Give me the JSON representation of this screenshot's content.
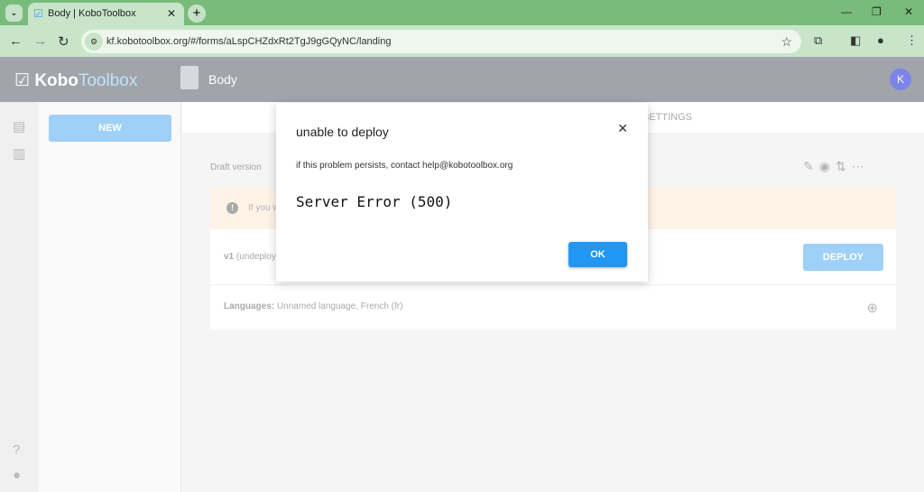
{
  "browser": {
    "tab_title": "Body | KoboToolbox",
    "url": "kf.kobotoolbox.org/#/forms/aLspCHZdxRt2TgJ9gGQyNC/landing"
  },
  "header": {
    "logo_a": "Kobo",
    "logo_b": "Toolbox",
    "title": "Body",
    "avatar": "K"
  },
  "sidebar": {
    "new_label": "NEW"
  },
  "topnav": {
    "settings": "SETTINGS"
  },
  "main": {
    "draft": "Draft version",
    "alert": "If you w",
    "version": "v1",
    "version_status": "(undeploy",
    "deploy": "DEPLOY",
    "languages_label": "Languages:",
    "languages": "Unnamed language, French (fr)"
  },
  "modal": {
    "title": "unable to deploy",
    "message": "if this problem persists, contact help@kobotoolbox.org",
    "error": "Server Error (500)",
    "ok": "OK"
  },
  "colors": {
    "accent": "#2196f3",
    "header": "#a1a4ab",
    "browser": "#79bb7b"
  }
}
